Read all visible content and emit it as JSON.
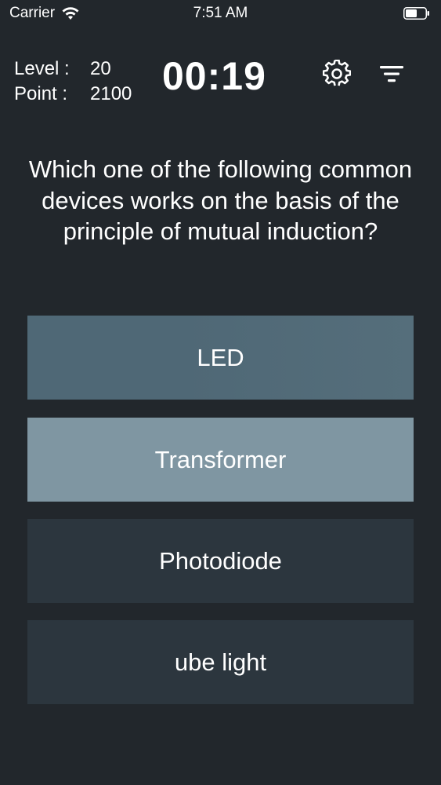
{
  "status_bar": {
    "carrier": "Carrier",
    "time": "7:51 AM",
    "wifi_icon": "wifi-icon",
    "battery_icon": "battery-icon"
  },
  "header": {
    "level_label": "Level",
    "level_value": "20",
    "point_label": "Point",
    "point_value": "2100",
    "timer": "00:19",
    "settings_icon": "gear-icon",
    "menu_icon": "filter-icon"
  },
  "question": "Which one of the following common devices works on the basis of the principle of mutual induction?",
  "answers": [
    {
      "label": "LED",
      "color": "#4f6876"
    },
    {
      "label": "Transformer",
      "color": "#7f96a2"
    },
    {
      "label": "Photodiode",
      "color": "#2c363e"
    },
    {
      "label": "ube light",
      "color": "#2c363e"
    }
  ],
  "colors": {
    "background": "#22272c"
  }
}
